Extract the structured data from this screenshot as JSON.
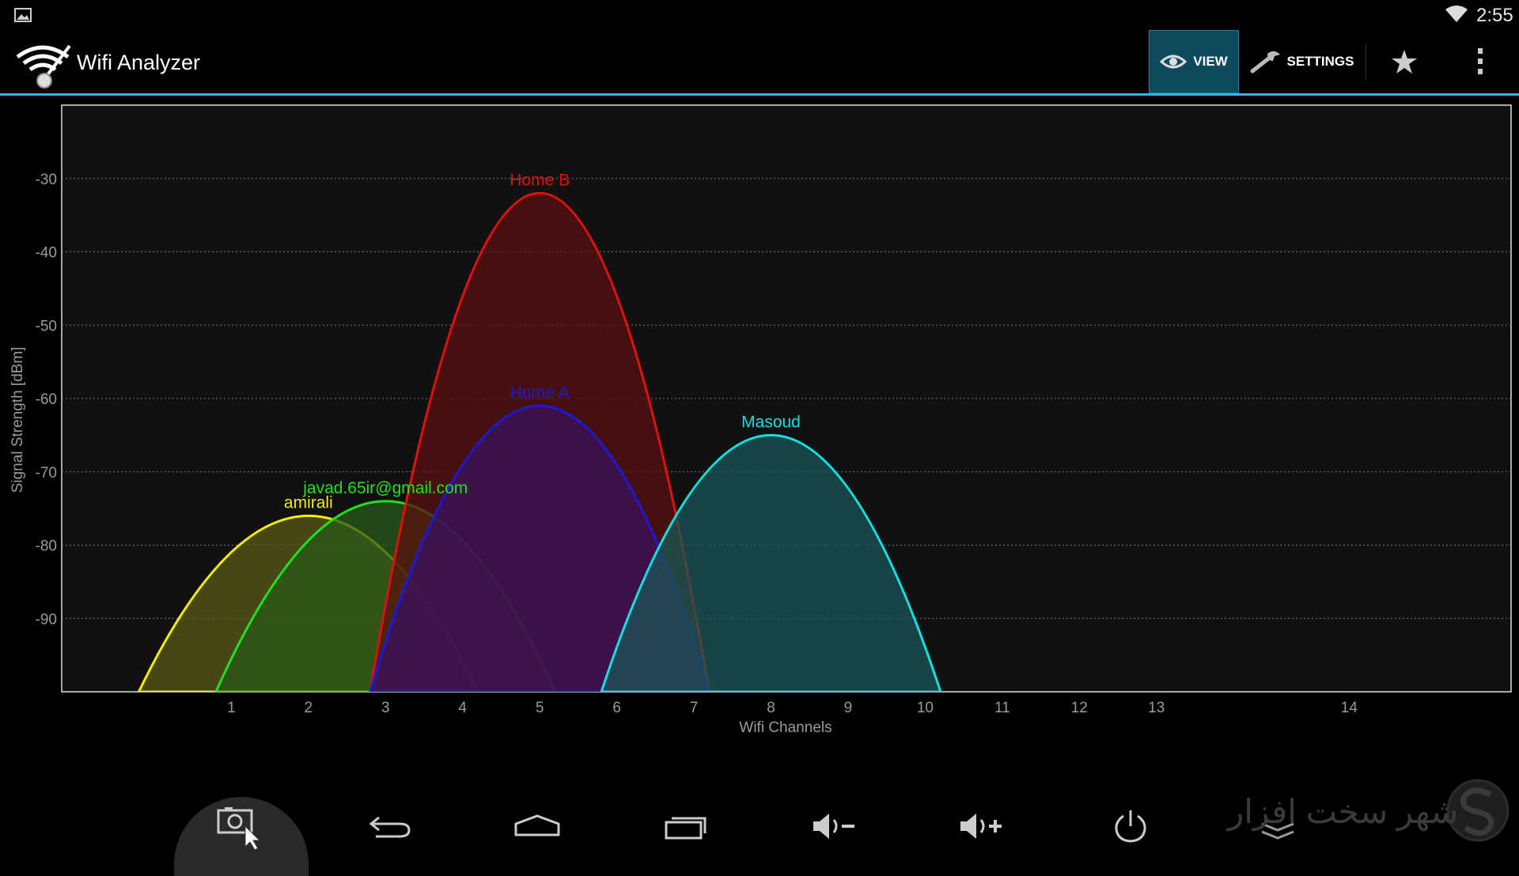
{
  "status_bar": {
    "time": "2:55"
  },
  "action_bar": {
    "title": "Wifi Analyzer",
    "view_label": "VIEW",
    "settings_label": "SETTINGS",
    "accent_color": "#33b5e5"
  },
  "chart_data": {
    "type": "area",
    "title": "",
    "xlabel": "Wifi Channels",
    "ylabel": "Signal Strength [dBm]",
    "xlim": [
      -1.2,
      17.6
    ],
    "ylim": [
      -100,
      -20
    ],
    "y_ticks": [
      -30,
      -40,
      -50,
      -60,
      -70,
      -80,
      -90
    ],
    "x_ticks": [
      1,
      2,
      3,
      4,
      5,
      6,
      7,
      8,
      9,
      10,
      11,
      12,
      13,
      14
    ],
    "grid": true,
    "series": [
      {
        "name": "amirali",
        "channel": 2,
        "peak_dbm": -76,
        "color": "#f0f000",
        "fill": "#5a5a14"
      },
      {
        "name": "javad.65ir@gmail.com",
        "channel": 3,
        "peak_dbm": -74,
        "color": "#20e020",
        "fill": "#2a5a1a"
      },
      {
        "name": "Home B",
        "channel": 5,
        "peak_dbm": -32,
        "color": "#e01010",
        "fill": "#5a1010"
      },
      {
        "name": "Home A",
        "channel": 5,
        "peak_dbm": -61,
        "color": "#1a1adc",
        "fill": "#3a1060"
      },
      {
        "name": "Masoud",
        "channel": 8,
        "peak_dbm": -65,
        "color": "#10e0e0",
        "fill": "#1a5656"
      }
    ]
  },
  "watermark": {
    "text": "شهر سخت افزار"
  }
}
